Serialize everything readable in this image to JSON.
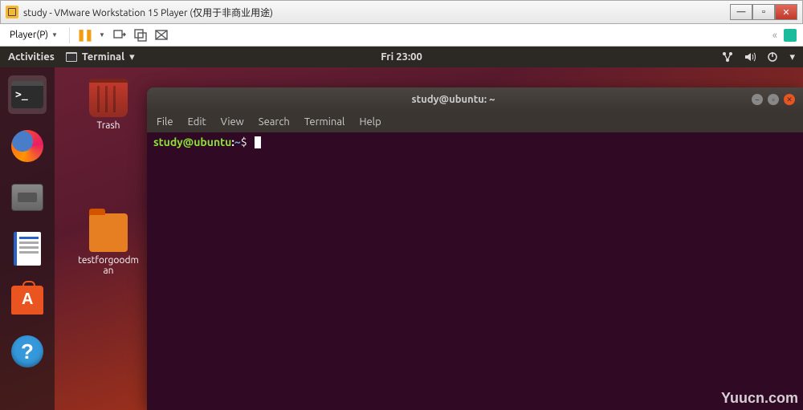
{
  "windows": {
    "title": "study - VMware Workstation 15 Player (仅用于非商业用途)",
    "min": "—",
    "max": "▫",
    "close": "✕"
  },
  "vmware": {
    "player_label": "Player(P)",
    "dropdown": "▼",
    "fullscreen_icon": "«"
  },
  "ubuntu_top": {
    "activities": "Activities",
    "app_label": "Terminal",
    "app_dropdown": "▾",
    "clock": "Fri 23:00",
    "power_dropdown": "▾"
  },
  "desktop_icons": {
    "trash": "Trash",
    "folder": "testforgoodman"
  },
  "terminal": {
    "title": "study@ubuntu: ~",
    "menu": [
      "File",
      "Edit",
      "View",
      "Search",
      "Terminal",
      "Help"
    ],
    "prompt_user": "study@ubuntu",
    "prompt_sep": ":",
    "prompt_path": "~",
    "prompt_sign": "$"
  },
  "dock_help": "?",
  "watermark": "Yuucn.com"
}
